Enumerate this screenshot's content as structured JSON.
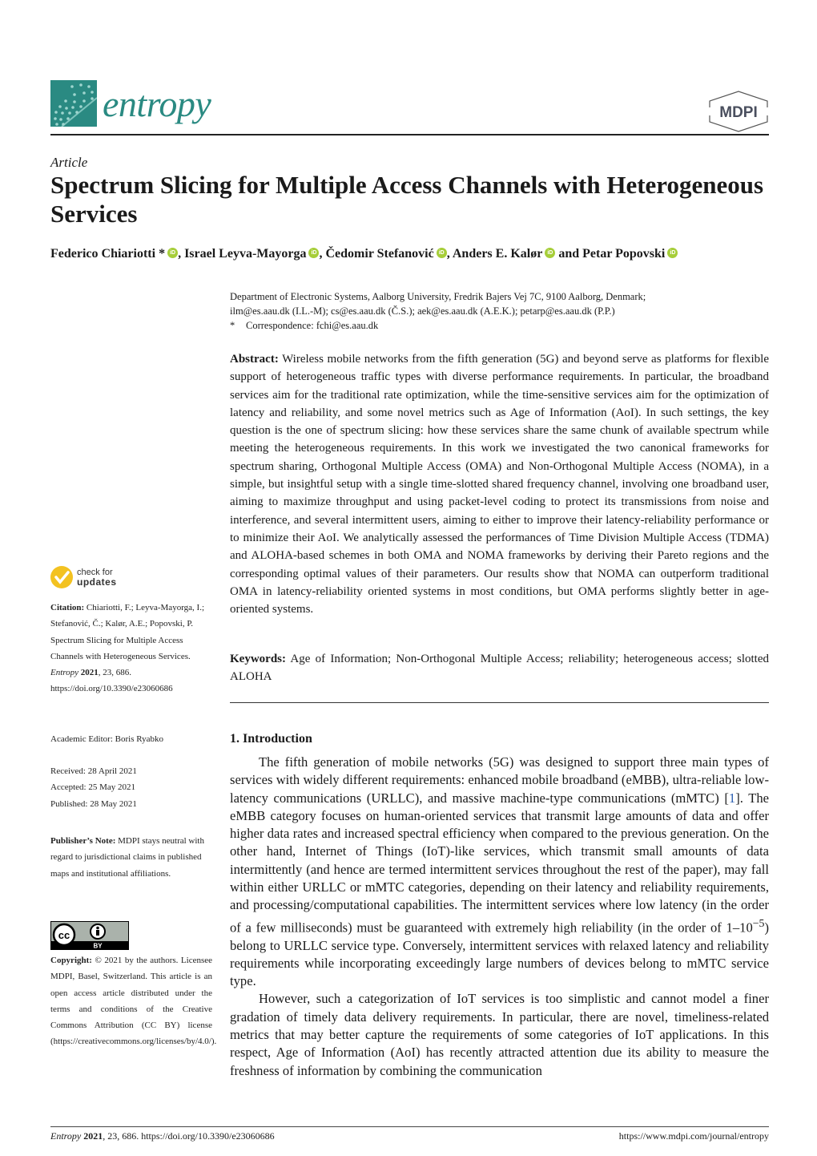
{
  "header": {
    "journal_name": "entropy",
    "publisher_logo": "MDPI"
  },
  "article": {
    "type": "Article",
    "title": "Spectrum Slicing for Multiple Access Channels with Heterogeneous Services",
    "authors": [
      {
        "name": "Federico Chiariotti *",
        "orcid": true
      },
      {
        "name": "Israel Leyva-Mayorga",
        "orcid": true
      },
      {
        "name": "Čedomir Stefanović",
        "orcid": true
      },
      {
        "name": "Anders E. Kalør",
        "orcid": true
      },
      {
        "name": "Petar Popovski",
        "orcid": true
      }
    ],
    "author_separators": [
      ", ",
      ", ",
      ", ",
      " and "
    ],
    "affiliation": "Department of Electronic Systems, Aalborg University, Fredrik Bajers Vej 7C, 9100 Aalborg, Denmark;",
    "emails": "ilm@es.aau.dk (I.L.-M); cs@es.aau.dk (Č.S.); aek@es.aau.dk (A.E.K.); petarp@es.aau.dk (P.P.)",
    "correspondence_marker": "*",
    "correspondence": "Correspondence: fchi@es.aau.dk",
    "abstract_label": "Abstract:",
    "abstract": "Wireless mobile networks from the fifth generation (5G) and beyond serve as platforms for flexible support of heterogeneous traffic types with diverse performance requirements. In particular, the broadband services aim for the traditional rate optimization, while the time-sensitive services aim for the optimization of latency and reliability, and some novel metrics such as Age of Information (AoI). In such settings, the key question is the one of spectrum slicing: how these services share the same chunk of available spectrum while meeting the heterogeneous requirements. In this work we investigated the two canonical frameworks for spectrum sharing, Orthogonal Multiple Access (OMA) and Non-Orthogonal Multiple Access (NOMA), in a simple, but insightful setup with a single time-slotted shared frequency channel, involving one broadband user, aiming to maximize throughput and using packet-level coding to protect its transmissions from noise and interference, and several intermittent users, aiming to either to improve their latency-reliability performance or to minimize their AoI. We analytically assessed the performances of Time Division Multiple Access (TDMA) and ALOHA-based schemes in both OMA and NOMA frameworks by deriving their Pareto regions and the corresponding optimal values of their parameters. Our results show that NOMA can outperform traditional OMA in latency-reliability oriented systems in most conditions, but OMA performs slightly better in age-oriented systems.",
    "keywords_label": "Keywords:",
    "keywords": "Age of Information; Non-Orthogonal Multiple Access; reliability; heterogeneous access; slotted ALOHA"
  },
  "intro": {
    "heading": "1. Introduction",
    "p1_a": "The fifth generation of mobile networks (5G) was designed to support three main types of services with widely different requirements: enhanced mobile broadband (eMBB), ultra-reliable low-latency communications (URLLC), and massive machine-type communications (mMTC) [",
    "p1_ref": "1",
    "p1_b": "]. The eMBB category focuses on human-oriented services that transmit large amounts of data and offer higher data rates and increased spectral efficiency when compared to the previous generation. On the other hand, Internet of Things (IoT)-like services, which transmit small amounts of data intermittently (and hence are termed intermittent services throughout the rest of the paper), may fall within either URLLC or mMTC categories, depending on their latency and reliability requirements, and processing/computational capabilities. The intermittent services where low latency (in the order of a few milliseconds) must be guaranteed with extremely high reliability (in the order of 1–10",
    "p1_sup": "−5",
    "p1_c": ") belong to URLLC service type. Conversely, intermittent services with relaxed latency and reliability requirements while incorporating exceedingly large numbers of devices belong to mMTC service type.",
    "p2": "However, such a categorization of IoT services is too simplistic and cannot model a finer gradation of timely data delivery requirements. In particular, there are novel, timeliness-related metrics that may better capture the requirements of some categories of IoT applications. In this respect, Age of Information (AoI) has recently attracted attention due its ability to measure the freshness of information by combining the communication"
  },
  "sidebar": {
    "check_updates_line1": "check for",
    "check_updates_line2": "updates",
    "citation_label": "Citation:",
    "citation_text": "Chiariotti, F.; Leyva-Mayorga, I.; Stefanović, Č.; Kalør, A.E.; Popovski, P. Spectrum Slicing for Multiple Access Channels with Heterogeneous Services.",
    "citation_journal": "Entropy",
    "citation_year": "2021",
    "citation_rest": ", 23, 686. https://doi.org/10.3390/e23060686",
    "academic_editor": "Academic Editor: Boris Ryabko",
    "received": "Received: 28 April 2021",
    "accepted": "Accepted: 25 May 2021",
    "published": "Published: 28 May 2021",
    "publisher_note_label": "Publisher’s Note:",
    "publisher_note": "MDPI stays neutral with regard to jurisdictional claims in published maps and institutional affiliations.",
    "cc_label": "BY",
    "copyright_label": "Copyright:",
    "copyright": "© 2021 by the authors. Licensee MDPI, Basel, Switzerland. This article is an open access article distributed under the terms and conditions of the Creative Commons Attribution (CC BY) license (https://creativecommons.org/licenses/by/4.0/)."
  },
  "footer": {
    "journal": "Entropy",
    "year": "2021",
    "rest": ", 23, 686. https://doi.org/10.3390/e23060686",
    "url": "https://www.mdpi.com/journal/entropy"
  }
}
